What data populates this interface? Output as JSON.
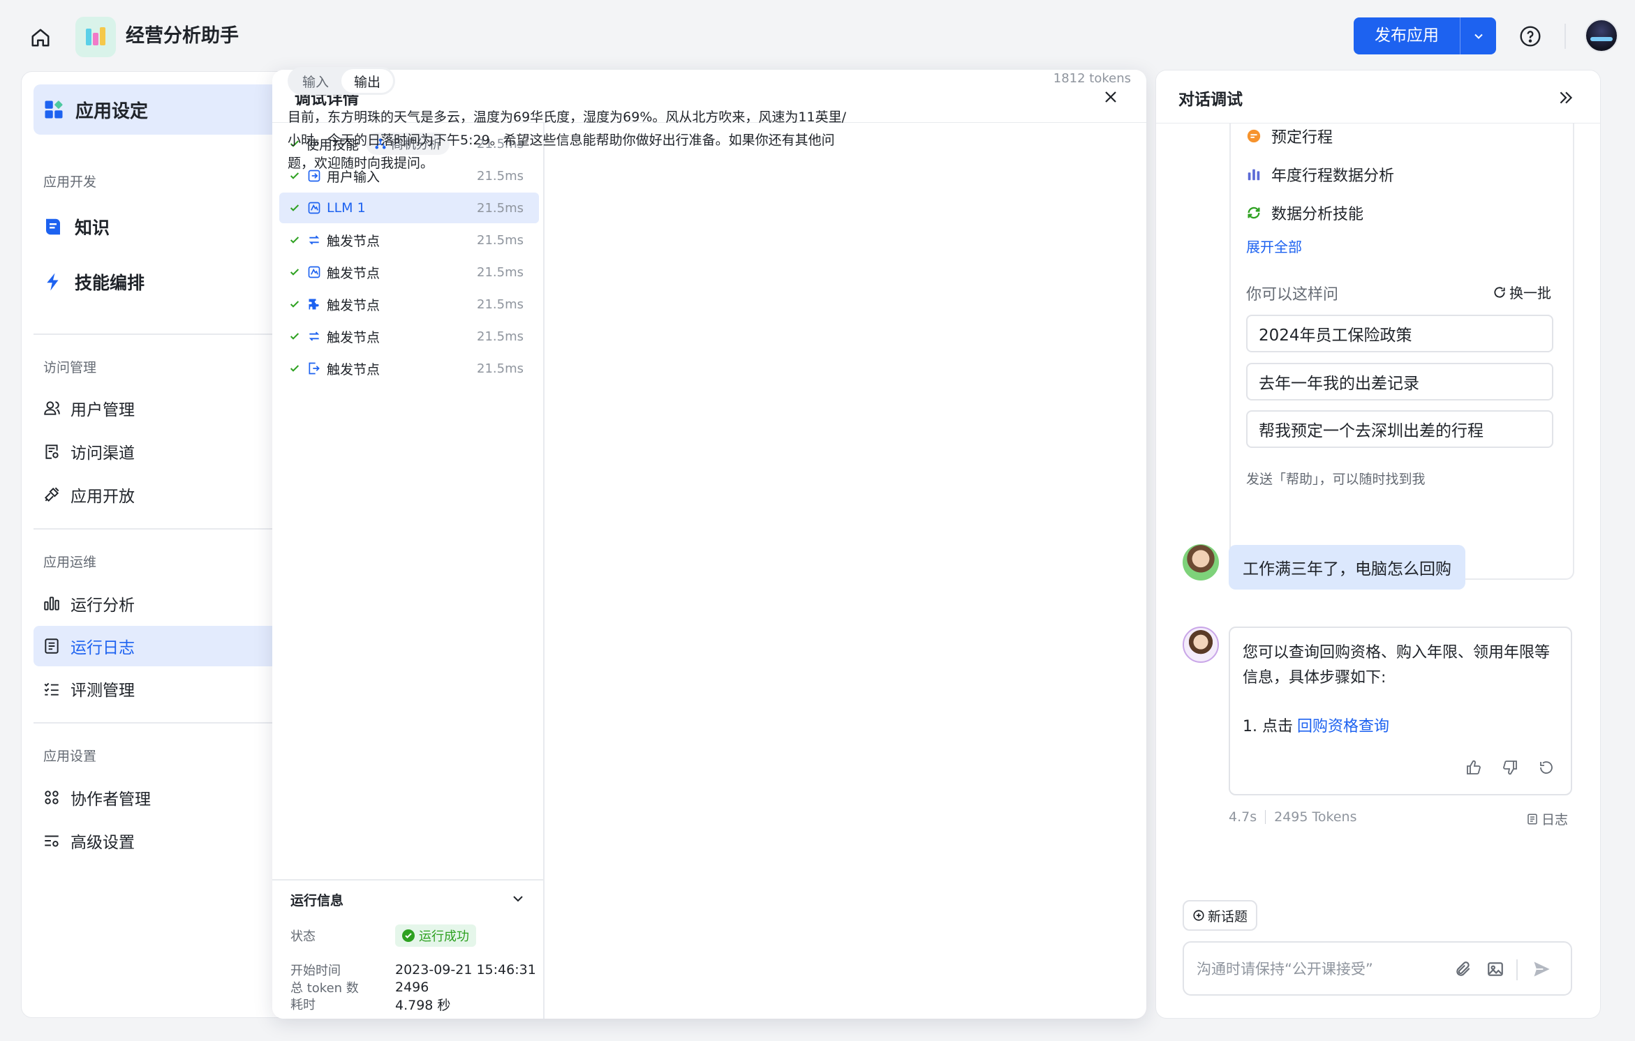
{
  "header": {
    "app_title": "经营分析助手",
    "publish_label": "发布应用"
  },
  "sidebar": {
    "active_head": "应用设定",
    "dev_section": "应用开发",
    "knowledge": "知识",
    "skill_orchestration": "技能编排",
    "access_section": "访问管理",
    "user_mgmt": "用户管理",
    "access_channel": "访问渠道",
    "app_open": "应用开放",
    "ops_section": "应用运维",
    "run_analysis": "运行分析",
    "run_log": "运行日志",
    "eval_mgmt": "评测管理",
    "settings_section": "应用设置",
    "collaborator_mgmt": "协作者管理",
    "advanced_settings": "高级设置"
  },
  "debug": {
    "title": "调试详情",
    "nodes": [
      {
        "label": "使用技能",
        "tag": "商机分析",
        "time": "21.5ms",
        "icon": "check-icon"
      },
      {
        "label": "用户输入",
        "time": "21.5ms",
        "icon": "input-node-icon"
      },
      {
        "label": "LLM 1",
        "time": "21.5ms",
        "icon": "llm-node-icon"
      },
      {
        "label": "触发节点",
        "time": "21.5ms",
        "icon": "swap-node-icon"
      },
      {
        "label": "触发节点",
        "time": "21.5ms",
        "icon": "llm-node-icon"
      },
      {
        "label": "触发节点",
        "time": "21.5ms",
        "icon": "puzzle-node-icon"
      },
      {
        "label": "触发节点",
        "time": "21.5ms",
        "icon": "swap-node-icon"
      },
      {
        "label": "触发节点",
        "time": "21.5ms",
        "icon": "output-node-icon"
      }
    ],
    "run_info": {
      "title": "运行信息",
      "status_key": "状态",
      "status_value": "运行成功",
      "start_key": "开始时间",
      "start_value": "2023-09-21 15:46:31",
      "duration_key": "耗时",
      "duration_value": "4.798 秒",
      "token_key": "总 token 数",
      "token_value": "2496"
    },
    "tabs": {
      "input": "输入",
      "output": "输出"
    },
    "tokens": "1812 tokens",
    "output_text": "目前，东方明珠的天气是多云，温度为69华氏度，湿度为69%。风从北方吹来，风速为11英里/小时。今天的日落时间为下午5:29。希望这些信息能帮助你做好出行准备。如果你还有其他问题，欢迎随时向我提问。"
  },
  "chat": {
    "title": "对话调试",
    "skills": [
      "预定行程",
      "年度行程数据分析",
      "数据分析技能"
    ],
    "expand_all": "展开全部",
    "ask_title": "你可以这样问",
    "refresh": "换一批",
    "suggestions": [
      "2024年员工保险政策",
      "去年一年我的出差记录",
      "帮我预定一个去深圳出差的行程"
    ],
    "help_tip": "发送「帮助」，可以随时找到我",
    "user_message": "工作满三年了，电脑怎么回购",
    "bot_message": "您可以查询回购资格、购入年限、领用年限等信息，具体步骤如下:",
    "bot_step_prefix": "1. 点击",
    "bot_step_link": "回购资格查询",
    "meta_time": "4.7s",
    "meta_tokens": "2495 Tokens",
    "log_label": "日志",
    "new_topic": "新话题",
    "input_placeholder": "沟通时请保持“公开课接受”"
  }
}
